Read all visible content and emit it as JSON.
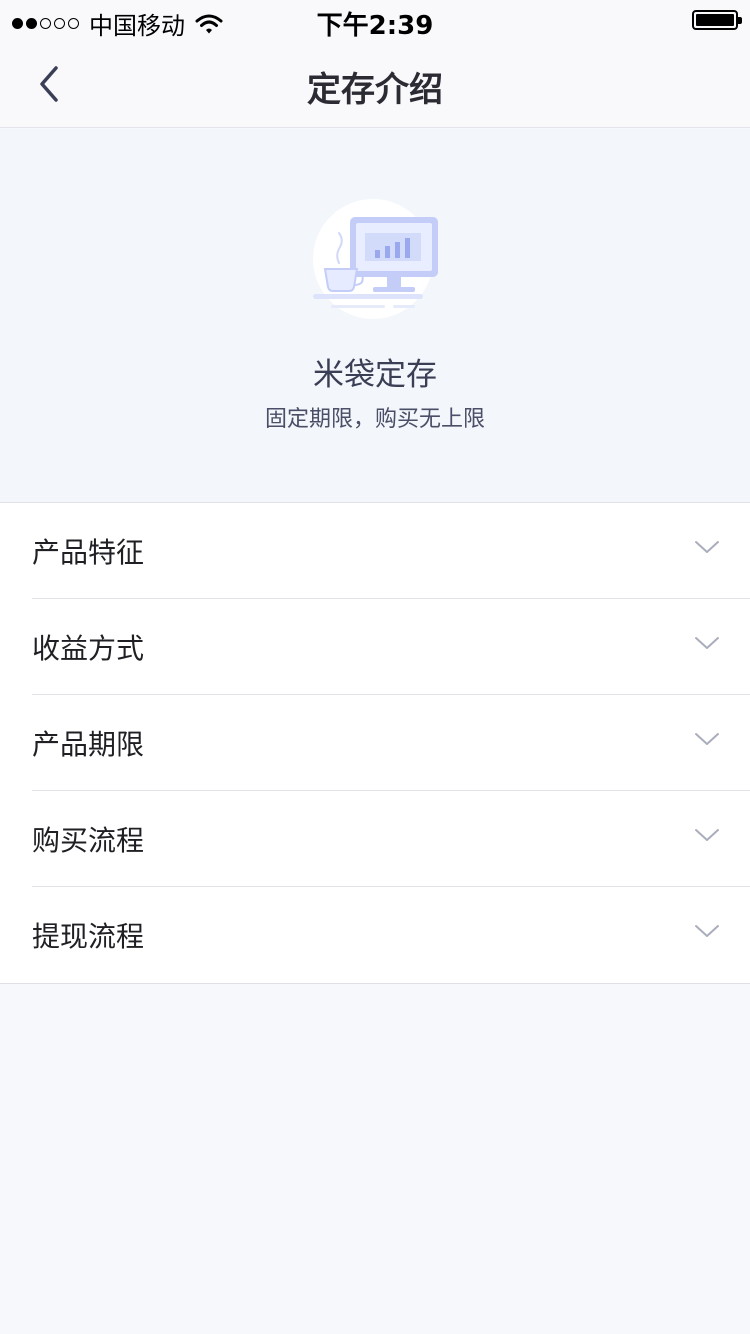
{
  "status_bar": {
    "signal_dots": [
      "on",
      "on",
      "off",
      "off",
      "off"
    ],
    "carrier": "中国移动",
    "time": "下午2:39"
  },
  "nav": {
    "title": "定存介绍",
    "back_icon": "chevron-left-icon"
  },
  "hero": {
    "illustration_icon": "computer-coffee-illustration",
    "title": "米袋定存",
    "subtitle": "固定期限，购买无上限"
  },
  "list": {
    "items": [
      {
        "label": "产品特征",
        "icon": "chevron-down-icon"
      },
      {
        "label": "收益方式",
        "icon": "chevron-down-icon"
      },
      {
        "label": "产品期限",
        "icon": "chevron-down-icon"
      },
      {
        "label": "购买流程",
        "icon": "chevron-down-icon"
      },
      {
        "label": "提现流程",
        "icon": "chevron-down-icon"
      }
    ]
  },
  "colors": {
    "page_background": "#f6f8fc",
    "hero_background": "#f3f6fb",
    "accent_illustration": "#b9c4f7",
    "chevron": "#a9adbd"
  }
}
